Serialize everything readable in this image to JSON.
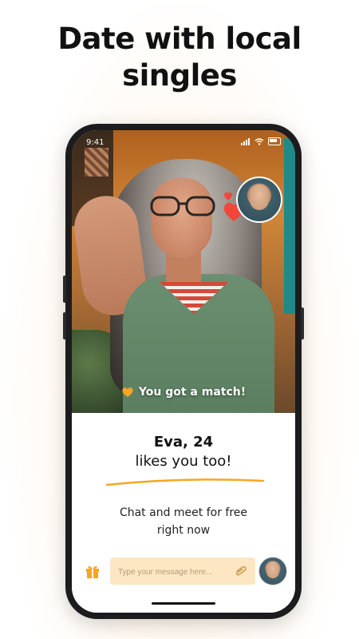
{
  "headline": {
    "line1": "Date with local",
    "line2": "singles"
  },
  "status_bar": {
    "time": "9:41"
  },
  "photo": {
    "match_banner": "You got a match!",
    "match_icon": "heart-icon"
  },
  "match": {
    "name_age": "Eva, 24",
    "subtitle": "likes you too!",
    "cta_line1": "Chat and meet for free",
    "cta_line2": "right now"
  },
  "composer": {
    "placeholder": "Type your message here...",
    "gift_icon": "gift-icon",
    "attach_icon": "paperclip-icon"
  },
  "colors": {
    "accent": "#f5a623",
    "input_bg": "#fde6c2",
    "heart": "#f2463a"
  }
}
